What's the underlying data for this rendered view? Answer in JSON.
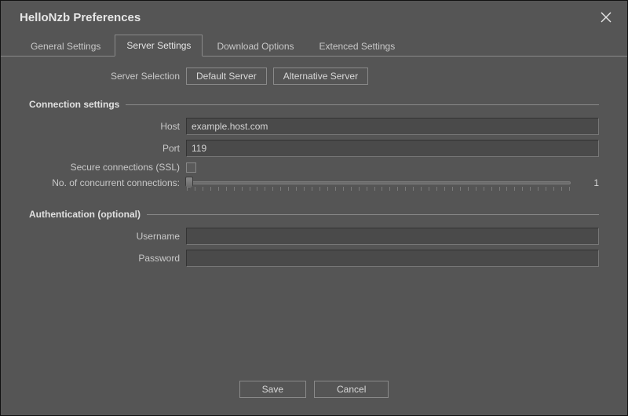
{
  "window": {
    "title": "HelloNzb Preferences"
  },
  "tabs": {
    "general": "General Settings",
    "server": "Server Settings",
    "download": "Download Options",
    "extended": "Extenced Settings",
    "active": "server"
  },
  "server_selection": {
    "label": "Server Selection",
    "default_btn": "Default Server",
    "alt_btn": "Alternative Server"
  },
  "sections": {
    "connection_title": "Connection settings",
    "auth_title": "Authentication (optional)"
  },
  "fields": {
    "host_label": "Host",
    "host_value": "example.host.com",
    "port_label": "Port",
    "port_value": "119",
    "ssl_label": "Secure connections (SSL)",
    "ssl_checked": false,
    "conn_label": "No. of concurrent connections:",
    "conn_value": "1",
    "username_label": "Username",
    "username_value": "",
    "password_label": "Password",
    "password_value": ""
  },
  "footer": {
    "save": "Save",
    "cancel": "Cancel"
  }
}
